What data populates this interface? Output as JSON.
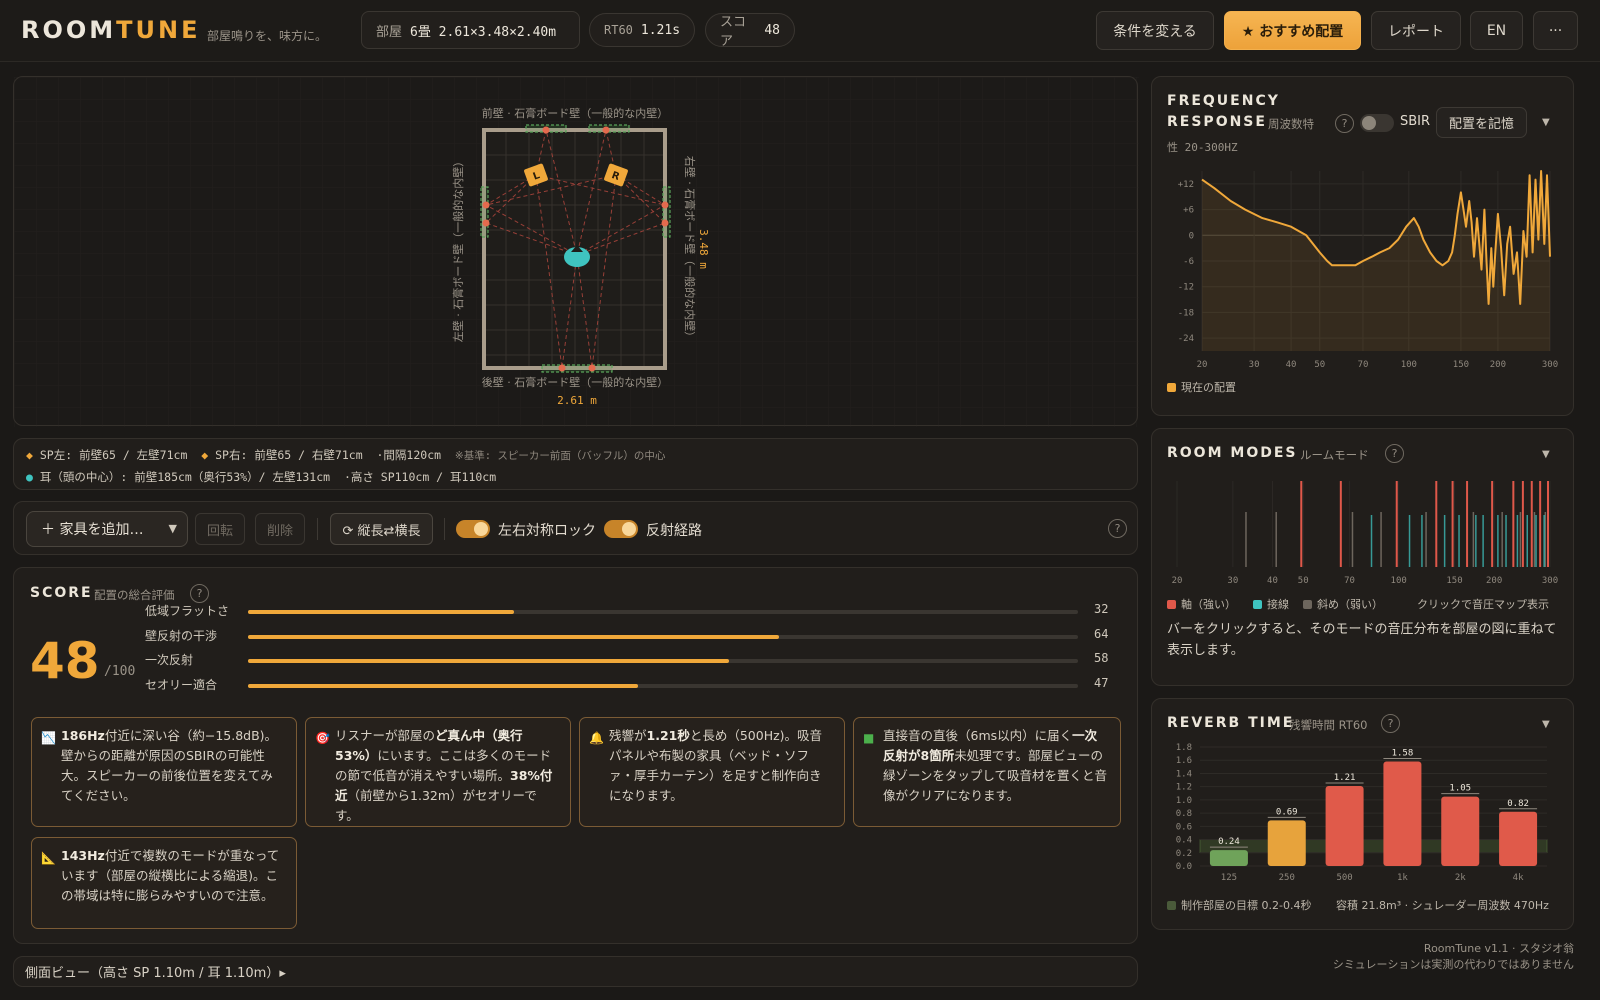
{
  "app": {
    "logo_a": "ROOM",
    "logo_b": "TUNE",
    "tagline": "部屋鳴りを、味方に。"
  },
  "header": {
    "room_key": "部屋",
    "room_val": "6畳 2.61×3.48×2.40m",
    "rt60_key": "RT60",
    "rt60_val": "1.21s",
    "score_key": "スコア",
    "score_val": "48",
    "change_btn": "条件を変える",
    "recommend_btn": "★ おすすめ配置",
    "report_btn": "レポート",
    "lang_btn": "EN",
    "more_btn": "···"
  },
  "room": {
    "front_wall": "前壁 · 石膏ボード壁（一般的な内壁）",
    "back_wall": "後壁 · 石膏ボード壁（一般的な内壁）",
    "left_wall": "左壁 · 石膏ボード壁（一般的な内壁）",
    "right_wall": "右壁 · 石膏ボード壁（一般的な内壁）",
    "width_label": "2.61 m",
    "depth_label": "3.48 m",
    "sp_l": "L",
    "sp_r": "R"
  },
  "info": {
    "line1": "SP左: 前壁65 / 左壁71cm",
    "line1b": "SP右: 前壁65 / 右壁71cm",
    "line1c": "·間隔120cm",
    "line1note": "※基準: スピーカー前面（バッフル）の中心",
    "line2": "耳（頭の中心）: 前壁185cm（奥行53%）/ 左壁131cm",
    "line2b": "·高さ SP110cm / 耳110cm",
    "sp_color": "#f0a83a",
    "ear_color": "#3fc4c0"
  },
  "tools": {
    "add_furniture": "＋ 家具を追加…",
    "rotate": "回転",
    "delete": "削除",
    "swap": "⟳ 縦長⇄横長",
    "sym_lock": "左右対称ロック",
    "reflection": "反射経路",
    "help": "?"
  },
  "score": {
    "title": "SCORE",
    "subtitle": "配置の総合評価",
    "help": "?",
    "value": "48",
    "denominator": "/100",
    "metrics": [
      {
        "label": "低域フラットさ",
        "value": 32,
        "text": "32"
      },
      {
        "label": "壁反射の干渉",
        "value": 64,
        "text": "64"
      },
      {
        "label": "一次反射",
        "value": 58,
        "text": "58"
      },
      {
        "label": "セオリー適合",
        "value": 47,
        "text": "47"
      }
    ],
    "cards": [
      {
        "icon": "chart-icon",
        "pre": "",
        "bold": "186Hz",
        "post": "付近に深い谷（約−15.8dB)。壁からの距離が原因のSBIRの可能性大。スピーカーの前後位置を変えてみてください。"
      },
      {
        "icon": "target-icon",
        "pre": "リスナーが部屋の",
        "bold": "ど真ん中（奥行53%）",
        "post": "にいます。ここは多くのモードの節で低音が消えやすい場所。",
        "bold2": "38%付近",
        "post2": "（前壁から1.32m）がセオリーです。"
      },
      {
        "icon": "bell-icon",
        "pre": "残響が",
        "bold": "1.21秒",
        "post": "と長め（500Hz)。吸音パネルや布製の家具（ベッド・ソファ・厚手カーテン）を足すと制作向きになります。"
      },
      {
        "icon": "green-square-icon",
        "pre": "直接音の直後（6ms以内）に届く",
        "bold": "一次反射が8箇所",
        "post": "未処理です。部屋ビューの緑ゾーンをタップして吸音材を置くと音像がクリアになります。"
      },
      {
        "icon": "triangle-ruler-icon",
        "pre": "",
        "bold": "143Hz",
        "post": "付近で複数のモードが重なっています（部屋の縦横比による縮退)。この帯域は特に膨らみやすいので注意。"
      }
    ]
  },
  "side_view": {
    "label": "側面ビュー（高さ SP 1.10m / 耳 1.10m）▸"
  },
  "freq": {
    "title1": "FREQUENCY",
    "title2": "RESPONSE",
    "subtitle": "周波数特",
    "subtitle2": "性 20-300HZ",
    "help": "?",
    "sbir": "SBIR",
    "remember": "配置を記憶",
    "legend": "現在の配置",
    "color": "#f0a83a"
  },
  "modes": {
    "title": "ROOM MODES",
    "subtitle": "ルームモード",
    "help": "?",
    "legend_axial": "軸（強い）",
    "legend_tangential": "接線",
    "legend_oblique": "斜め（弱い）",
    "legend_hint": "クリックで音圧マップ表示",
    "description": "バーをクリックすると、そのモードの音圧分布を部屋の図に重ねて表示します。",
    "axial_color": "#e0584a",
    "tangential_color": "#3fc4c0",
    "oblique_color": "#6d665d"
  },
  "reverb": {
    "title": "REVERB TIME",
    "subtitle": "残響時間 RT60",
    "help": "?",
    "legend": "制作部屋の目標 0.2-0.4秒",
    "volume": "容積 21.8m³ · シュレーダー周波数 470Hz"
  },
  "footer": {
    "line1": "RoomTune v1.1 · スタジオ翁",
    "line2": "シミュレーションは実測の代わりではありません"
  },
  "chart_data": [
    {
      "type": "line",
      "title": "FREQUENCY RESPONSE",
      "x_scale": "log",
      "xlim": [
        20,
        300
      ],
      "ylim": [
        -27,
        15
      ],
      "x_ticks": [
        20,
        30,
        40,
        50,
        70,
        100,
        150,
        200,
        300
      ],
      "y_ticks": [
        12,
        6,
        0,
        -6,
        -12,
        -18,
        -24
      ],
      "series": [
        {
          "name": "現在の配置",
          "x": [
            20,
            22,
            25,
            28,
            32,
            36,
            40,
            45,
            50,
            53,
            55,
            58,
            62,
            66,
            70,
            75,
            80,
            86,
            92,
            98,
            104,
            108,
            112,
            118,
            124,
            130,
            136,
            140,
            143,
            146,
            150,
            153,
            156,
            160,
            163,
            166,
            170,
            173,
            176,
            180,
            183,
            186,
            190,
            193,
            196,
            200,
            205,
            210,
            215,
            220,
            226,
            232,
            238,
            244,
            250,
            256,
            262,
            268,
            274,
            280,
            287,
            293,
            300
          ],
          "y": [
            13,
            11,
            8,
            6,
            4,
            3,
            2,
            0,
            -4,
            -6,
            -7,
            -7,
            -7,
            -7,
            -6,
            -5,
            -4,
            -3,
            -1,
            2,
            4,
            2,
            -1,
            -4,
            -6,
            -7,
            -6,
            -4,
            0,
            5,
            10,
            6,
            2,
            8,
            3,
            -5,
            4,
            -2,
            -8,
            6,
            -6,
            -16,
            -3,
            -12,
            -4,
            5,
            -3,
            -14,
            -2,
            2,
            -9,
            -4,
            -16,
            1,
            -5,
            14,
            -4,
            13,
            -1,
            15,
            -2,
            14,
            -5
          ]
        }
      ]
    },
    {
      "type": "bar",
      "title": "ROOM MODES",
      "x_scale": "log",
      "xlim": [
        20,
        300
      ],
      "x_ticks": [
        20,
        30,
        40,
        50,
        70,
        100,
        150,
        200,
        300
      ],
      "axial": [
        49.3,
        65.7,
        98.6,
        131.4,
        147.9,
        164.3,
        197.1,
        229.9,
        246.4,
        262.8,
        279.3,
        295.7
      ],
      "tangential": [
        82.1,
        108.2,
        118.4,
        139.6,
        155.0,
        175.1,
        184.6,
        205.5,
        218.0,
        236.8,
        254.3,
        271.1,
        287.5
      ],
      "oblique": [
        33.0,
        41.1,
        71.5,
        88.0,
        122.0,
        172.0,
        212.0,
        242.0,
        268.0,
        290.0
      ]
    },
    {
      "type": "bar",
      "title": "REVERB TIME",
      "categories": [
        "125",
        "250",
        "500",
        "1k",
        "2k",
        "4k"
      ],
      "values": [
        0.24,
        0.69,
        1.21,
        1.58,
        1.05,
        0.82
      ],
      "labels": [
        "0.24",
        "0.69",
        "1.21",
        "1.58",
        "1.05",
        "0.82"
      ],
      "ylim": [
        0,
        1.8
      ],
      "y_ticks": [
        0.0,
        0.2,
        0.4,
        0.6,
        0.8,
        1.0,
        1.2,
        1.4,
        1.6,
        1.8
      ],
      "target_range": [
        0.2,
        0.4
      ],
      "bar_colors": [
        "#6fa35a",
        "#e7a33c",
        "#e05a4a",
        "#e05a4a",
        "#e05a4a",
        "#e05a4a"
      ]
    }
  ]
}
